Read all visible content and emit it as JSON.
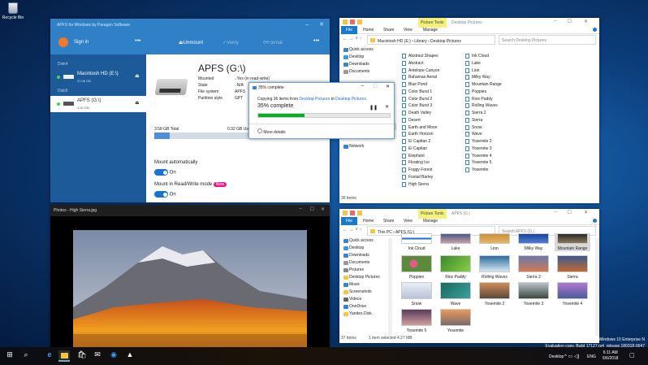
{
  "desktop": {
    "recycle_bin": "Recycle Bin",
    "watermark": [
      "Windows 10 Enterprise N",
      "Evaluation copy. Build 17127.rs4_release.180318-0047"
    ]
  },
  "apfs": {
    "title": "APFS for Windows by Paragon Software",
    "sign_in": "Sign in",
    "unmount": "Unmount",
    "verify": "Verify",
    "format": "Format",
    "disks": [
      {
        "group": "Disk4",
        "name": "Macintosh HD (E:\\)",
        "size": "37.06 GB"
      },
      {
        "group": "Disk5",
        "name": "APFS (G:\\)",
        "size": "3.50 GB",
        "selected": true
      }
    ],
    "volume_title": "APFS (G:\\)",
    "props": [
      {
        "k": "Mounted",
        "v": "Yes (in read-write)"
      },
      {
        "k": "State",
        "v": "N/A"
      },
      {
        "k": "File system",
        "v": "APFS"
      },
      {
        "k": "Partition style",
        "v": "GPT"
      }
    ],
    "total": "3.58 GB Total",
    "used": "0.32 GB Used",
    "used_fraction": 0.09,
    "mount_auto": "Mount automatically",
    "mount_auto_state": "On",
    "mount_rw": "Mount in Read/Write mode",
    "beta": "Beta",
    "mount_rw_state": "On",
    "beta_color": "#e4168a"
  },
  "progress": {
    "title": "35% complete",
    "copy_prefix": "Copying 36 items from ",
    "src": "Desktop Pictures",
    "to": " to ",
    "dst": "Desktop Pictures",
    "percent_label": "35% complete",
    "percent": 35,
    "more": "More details"
  },
  "explorer1": {
    "picture_tools": "Picture Tools",
    "title": "Desktop Pictures",
    "tabs": [
      "File",
      "Home",
      "Share",
      "View",
      "Manage"
    ],
    "path": [
      "Macintosh HD (E:)",
      "Library",
      "Desktop Pictures"
    ],
    "search": "Search Desktop Pictures",
    "nav": [
      "Quick access",
      "Desktop",
      "Downloads",
      "Documents",
      "Yandex.Disk",
      "This PC",
      "USB Drive (F:)",
      "Network"
    ],
    "files": [
      "Abstract Shapes",
      "Abstract",
      "Antelope Canyon",
      "Bahamas Aerial",
      "Blue Pond",
      "Color Burst 1",
      "Color Burst 2",
      "Color Burst 3",
      "Death Valley",
      "Desert",
      "Earth and Moon",
      "Earth Horizon",
      "El Capitan 2",
      "El Capitan",
      "Elephant",
      "Floating Ice",
      "Foggy Forest",
      "Foxtail Barley",
      "High Sierra",
      "Ink Cloud",
      "Lake",
      "Lion",
      "Milky Way",
      "Mountain Range",
      "Poppies",
      "Rice Paddy",
      "Rolling Waves",
      "Sierra 2",
      "Sierra",
      "Snow",
      "Wave",
      "Yosemite 2",
      "Yosemite 3",
      "Yosemite 4",
      "Yosemite 5",
      "Yosemite"
    ],
    "status": "36 items"
  },
  "explorer2": {
    "picture_tools": "Picture Tools",
    "title": "APFS (G:)",
    "tabs": [
      "File",
      "Home",
      "Share",
      "View",
      "Manage"
    ],
    "path": [
      "This PC",
      "APFS (G:)"
    ],
    "search": "Search APFS (G:)",
    "nav": [
      "Quick access",
      "Desktop",
      "Downloads",
      "Documents",
      "Pictures",
      "Desktop Pictures",
      "Music",
      "Screenshots",
      "Videos",
      "OneDrive",
      "Yandex.Disk"
    ],
    "thumbs": [
      {
        "n": "Ink Cloud",
        "c": "linear-gradient(#fff,#fff 40%,#1c6fd0 40%,#1c6fd0 60%,#fff 60%)"
      },
      {
        "n": "Lake",
        "c": "linear-gradient(#4a5a8a,#c9a0a0)"
      },
      {
        "n": "Lion",
        "c": "linear-gradient(#c8923a,#e6b566)"
      },
      {
        "n": "Milky Way",
        "c": "linear-gradient(#1c3f9a,#4e7fd6)"
      },
      {
        "n": "Mountain Range",
        "c": "linear-gradient(#2a2a2a,#8a7a5a)",
        "sel": true
      },
      {
        "n": "Poppies",
        "c": "radial-gradient(circle at 40% 50%,#e05a8a 20%,#5a8a3a 22%)"
      },
      {
        "n": "Rice Paddy",
        "c": "linear-gradient(135deg,#3a8a2a,#8acd4a)"
      },
      {
        "n": "Rolling Waves",
        "c": "linear-gradient(#2a6aa0,#d8e8f0)"
      },
      {
        "n": "Sierra 2",
        "c": "linear-gradient(#6a7ab0,#d07a50)"
      },
      {
        "n": "Sierra",
        "c": "linear-gradient(#3a5a90,#c06a30)"
      },
      {
        "n": "Snow",
        "c": "linear-gradient(#e8eef6,#b8c4d8)"
      },
      {
        "n": "Wave",
        "c": "linear-gradient(135deg,#1a6a5a,#3aa0a0)"
      },
      {
        "n": "Yosemite 2",
        "c": "linear-gradient(#d08a5a,#5a4a3a)"
      },
      {
        "n": "Yosemite 3",
        "c": "linear-gradient(#b8c0c8,#3a4a3a)"
      },
      {
        "n": "Yosemite 4",
        "c": "linear-gradient(#b07ad0,#4a5a9a)"
      },
      {
        "n": "Yosemite 5",
        "c": "linear-gradient(#5a3a5a,#d0a0a0)"
      },
      {
        "n": "Yosemite",
        "c": "linear-gradient(#e89a5a,#7a6a6a)"
      }
    ],
    "status": "37 items",
    "selection": "1 item selected  4.27 MB"
  },
  "photos": {
    "title": "Photos - High Sierra.jpg"
  },
  "taskbar": {
    "desktop": "Desktop",
    "lang": "ENG",
    "time": "6:11 AM",
    "date": "6/6/2018"
  }
}
